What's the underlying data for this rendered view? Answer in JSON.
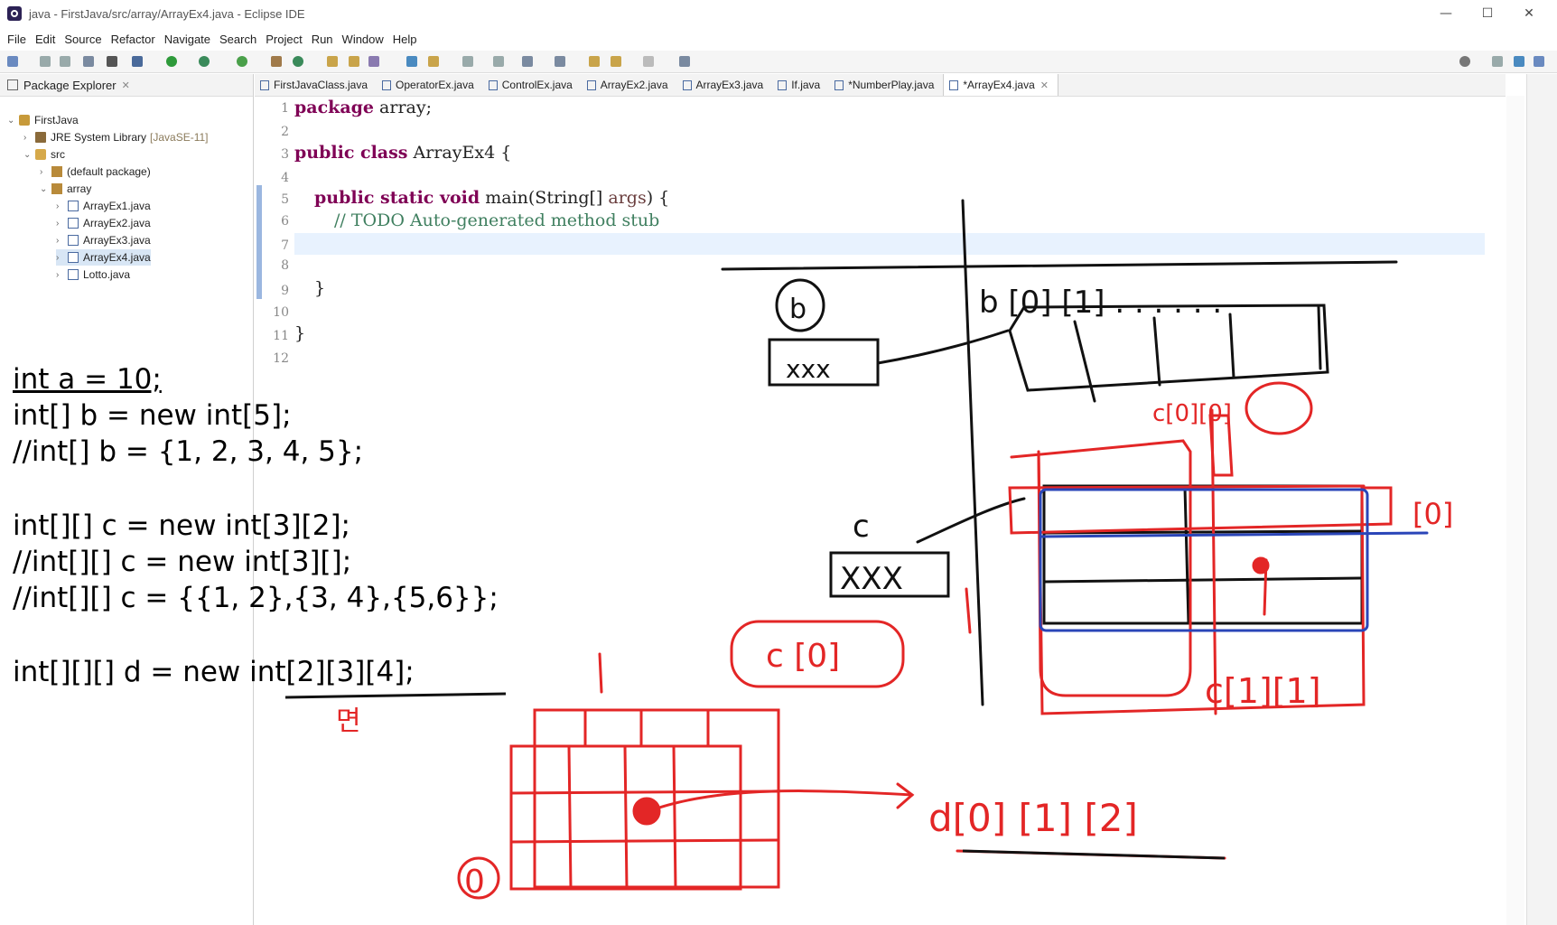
{
  "window": {
    "title": "java - FirstJava/src/array/ArrayEx4.java - Eclipse IDE",
    "controls": {
      "minimize": "—",
      "maximize": "☐",
      "close": "✕"
    }
  },
  "menu": [
    "File",
    "Edit",
    "Source",
    "Refactor",
    "Navigate",
    "Search",
    "Project",
    "Run",
    "Window",
    "Help"
  ],
  "package_explorer": {
    "title": "Package Explorer",
    "tree": {
      "project": "FirstJava",
      "jre": "JRE System Library",
      "jre_tag": "[JavaSE-11]",
      "src": "src",
      "default_pkg": "(default package)",
      "array_pkg": "array",
      "files": [
        "ArrayEx1.java",
        "ArrayEx2.java",
        "ArrayEx3.java",
        "ArrayEx4.java",
        "Lotto.java"
      ]
    },
    "selected": "ArrayEx4.java"
  },
  "tabs": [
    "FirstJavaClass.java",
    "OperatorEx.java",
    "ControlEx.java",
    "ArrayEx2.java",
    "ArrayEx3.java",
    "If.java",
    "*NumberPlay.java",
    "*ArrayEx4.java"
  ],
  "code": {
    "line_numbers": [
      "1",
      "2",
      "3",
      "4",
      "5",
      "6",
      "7",
      "8",
      "9",
      "10",
      "11",
      "12"
    ],
    "l1_kw": "package",
    "l1_rest": " array;",
    "l3_kw": "public class",
    "l3_rest": " ArrayEx4 {",
    "l5_kw": "public static void",
    "l5_mid": " main(String[] ",
    "l5_param": "args",
    "l5_end": ") {",
    "l6": "// TODO Auto-generated method stub",
    "l9": "}",
    "l11": "}"
  },
  "overlay_code": [
    "int a = 10;",
    "int[] b = new int[5];",
    "//int[] b = {1, 2, 3, 4, 5};",
    "int[][] c = new int[3][2];",
    "//int[][] c = new int[3][];",
    "//int[][] c = {{1, 2},{3, 4},{5,6}};",
    "int[][][] d = new int[2][3][4];"
  ],
  "annotations": {
    "b_circle": "b",
    "b_box": "xxx",
    "b_row": "b [0] [1] . . . . . .",
    "c_label": "c",
    "c_box": "XXX",
    "c0_label": "c [0]",
    "c00": "c[0][0]",
    "row0": "[0]",
    "c11": "c[1][1]",
    "d_label": "d[0] [1] [2]",
    "myeon": "면",
    "zero": "0"
  },
  "colors": {
    "ink_black": "#111111",
    "ink_red": "#e32626",
    "ink_blue": "#2a45b8",
    "keyword": "#7f0055",
    "comment": "#3f7f5f"
  }
}
